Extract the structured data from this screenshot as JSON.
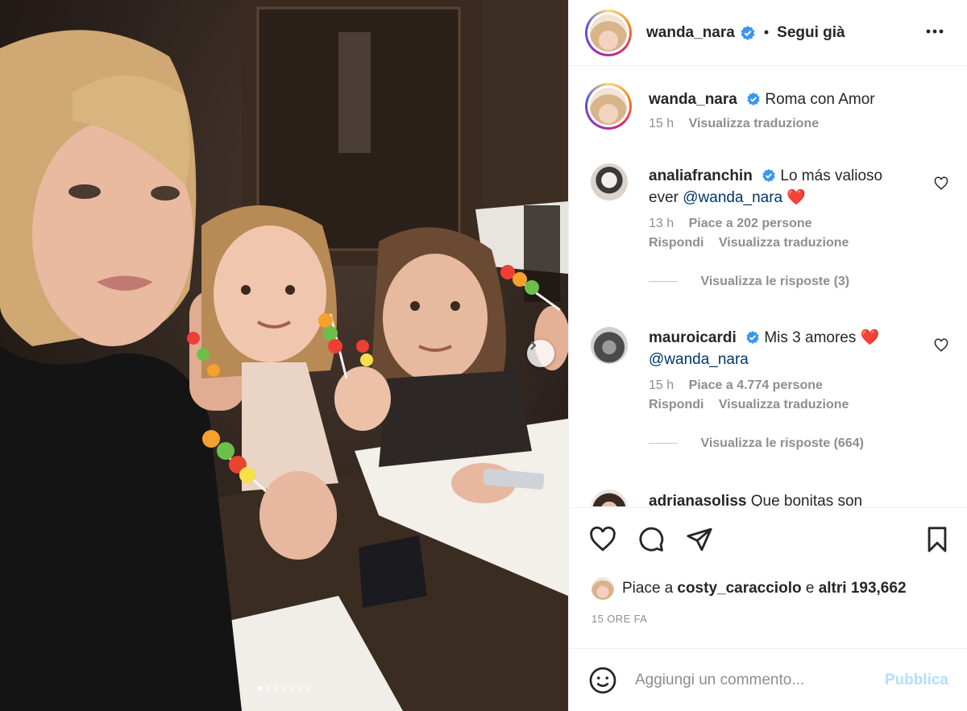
{
  "post": {
    "author": "wanda_nara",
    "follow_status": "Segui già",
    "separator": "•",
    "more_icon": "more-horizontal-icon",
    "carousel": {
      "total": 7,
      "current": 1
    }
  },
  "caption": {
    "username": "wanda_nara",
    "text": "Roma con Amor",
    "time": "15 h",
    "translate": "Visualizza traduzione"
  },
  "comments": [
    {
      "username": "analiafranchin",
      "text_before": "Lo más valioso ever ",
      "mention": "@wanda_nara",
      "emoji": "❤️",
      "time": "13 h",
      "likes": "Piace a 202 persone",
      "reply": "Rispondi",
      "translate": "Visualizza traduzione",
      "view_replies": "Visualizza le risposte (3)"
    },
    {
      "username": "mauroicardi",
      "text_before": "Mis 3 amores ",
      "emoji": "❤️",
      "mention": "@wanda_nara",
      "time": "15 h",
      "likes": "Piace a 4.774 persone",
      "reply": "Rispondi",
      "translate": "Visualizza traduzione",
      "view_replies": "Visualizza le risposte (664)"
    },
    {
      "username": "adrianasoliss",
      "text_before": "Que bonitas son"
    }
  ],
  "actions": {
    "like_icon": "heart-icon",
    "comment_icon": "comment-icon",
    "share_icon": "send-icon",
    "save_icon": "bookmark-icon"
  },
  "likes_summary": {
    "prefix": "Piace a ",
    "user": "costy_caracciolo",
    "middle": " e ",
    "others": "altri 193,662"
  },
  "time_ago": "15 ORE FA",
  "add_comment": {
    "placeholder": "Aggiungi un commento...",
    "publish": "Pubblica",
    "emoji_icon": "smiley-icon"
  },
  "colors": {
    "verified": "#3897f0",
    "publish_disabled": "#b2dffc",
    "heart_red": "#ed1c24",
    "meta_gray": "#8e8e8e"
  }
}
